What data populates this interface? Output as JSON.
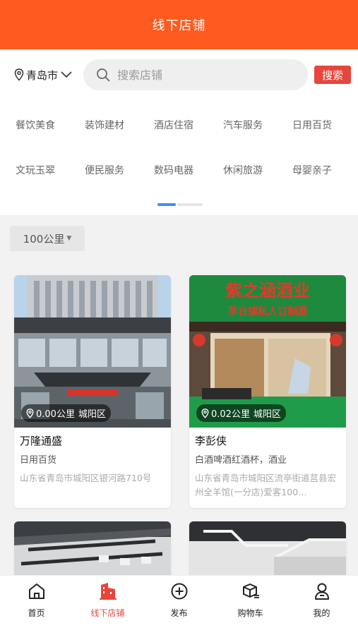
{
  "header": {
    "title": "线下店铺"
  },
  "location": {
    "city": "青岛市"
  },
  "search": {
    "placeholder": "搜索店铺",
    "button_label": "搜索"
  },
  "categories": [
    [
      "餐饮美食",
      "装饰建材",
      "酒店住宿",
      "汽车服务",
      "日用百货"
    ],
    [
      "文玩玉翠",
      "便民服务",
      "数码电器",
      "休闲旅游",
      "母婴亲子"
    ]
  ],
  "filter": {
    "distance_label": "100公里"
  },
  "shops": [
    {
      "distance": "0.00公里",
      "district": "城阳区",
      "name": "万隆通盛",
      "category": "日用百货",
      "address": "山东省青岛市城阳区银河路710号"
    },
    {
      "distance": "0.02公里",
      "district": "城阳区",
      "name": "李彭侠",
      "category": "白酒啤酒红酒杯，酒业",
      "address": "山东省青岛市城阳区流亭街道莒县宏州全羊馆(一分店)爱客100…",
      "sign_title": "紫之涵酒业",
      "sign_subtitle": "茅台镇私人订制酒"
    }
  ],
  "tabbar": {
    "items": [
      "首页",
      "线下店铺",
      "发布",
      "购物车",
      "我的"
    ],
    "active_index": 1
  },
  "colors": {
    "header": "#ff5a1f",
    "accent": "#e8453c",
    "pager": "#3d8ff5"
  }
}
